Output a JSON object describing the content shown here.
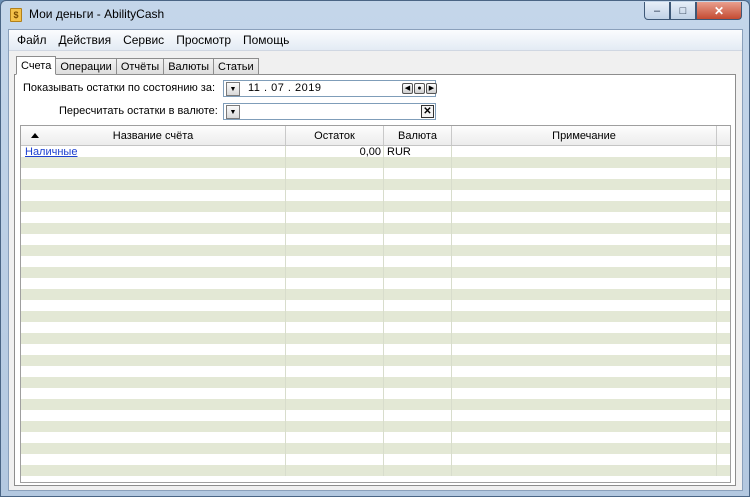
{
  "window": {
    "title": "Мои деньги - AbilityCash"
  },
  "menu": [
    "Файл",
    "Действия",
    "Сервис",
    "Просмотр",
    "Помощь"
  ],
  "tabs": [
    "Счета",
    "Операции",
    "Отчёты",
    "Валюты",
    "Статьи"
  ],
  "active_tab": "Счета",
  "filters": {
    "date_label": "Показывать остатки по состоянию за:",
    "date_value": "11 . 07 . 2019",
    "currency_label": "Пересчитать остатки в валюте:",
    "currency_value": ""
  },
  "table": {
    "columns": [
      "Название счёта",
      "Остаток",
      "Валюта",
      "Примечание"
    ],
    "sort": "ascending",
    "rows": [
      {
        "name": "Наличные",
        "balance": "0,00",
        "currency": "RUR",
        "note": ""
      }
    ]
  }
}
